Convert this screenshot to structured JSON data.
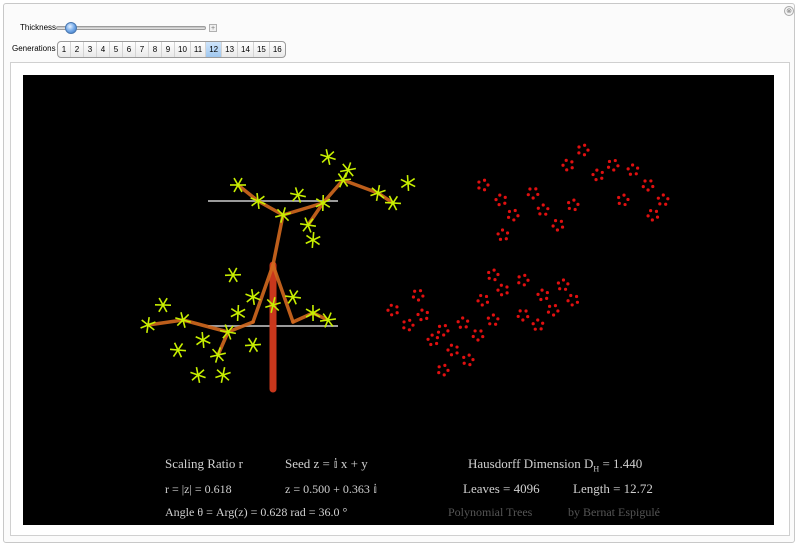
{
  "controls": {
    "thickness_label": "Thickness",
    "generations_label": "Generations",
    "generations": [
      "1",
      "2",
      "3",
      "4",
      "5",
      "6",
      "7",
      "8",
      "9",
      "10",
      "11",
      "12",
      "13",
      "14",
      "15",
      "16"
    ],
    "selected_generation": "12",
    "thickness_value": 0.1,
    "close_icon": "⊗",
    "plus_icon": "+"
  },
  "info": {
    "scaling_ratio": "Scaling Ratio r",
    "seed": "Seed    z = 𝕚 x + y",
    "r_value": "r = |z| = 0.618",
    "z_value": "z =    0.500 + 0.363 𝕚",
    "angle": "Angle   θ = Arg(z) = 0.628 rad = 36.0 °",
    "hausdorff": "Hausdorff Dimension D",
    "hausdorff_sub": "H",
    "hausdorff_value": " = 1.440",
    "leaves": "Leaves = 4096",
    "length": "Length = 12.72",
    "title": "Polynomial Trees",
    "author": "by Bernat Espigulé"
  },
  "colors": {
    "canvas_bg": "#000000",
    "trunk": "#c8371c",
    "branch": "#d2691e",
    "leaf": "#c8f000",
    "leaf_red": "#e01010",
    "baseline": "#9a9a9a",
    "selected_tab": "#a9cdf2"
  }
}
